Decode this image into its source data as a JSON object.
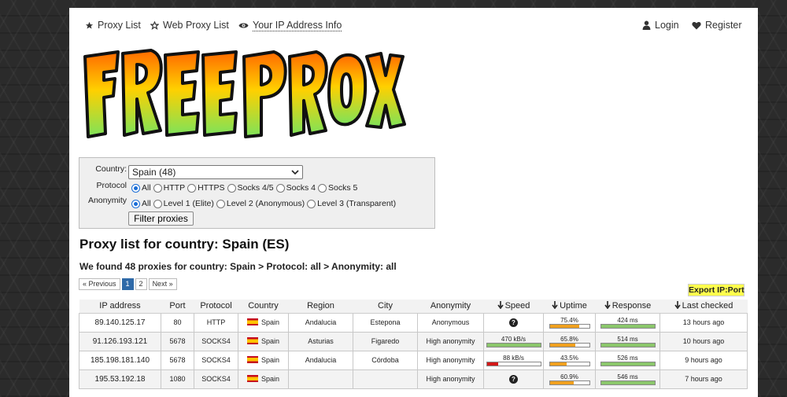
{
  "nav": {
    "proxy_list": "Proxy List",
    "web_proxy_list": "Web Proxy List",
    "ip_info": "Your IP Address Info",
    "login": "Login",
    "register": "Register"
  },
  "logo_text": "FREE PROXY",
  "filter": {
    "country_label": "Country:",
    "country_value": "Spain (48)",
    "protocol_label": "Protocol",
    "protocol_options": [
      "All",
      "HTTP",
      "HTTPS",
      "Socks 4/5",
      "Socks 4",
      "Socks 5"
    ],
    "protocol_selected": "All",
    "anonymity_label": "Anonymity",
    "anonymity_options": [
      "All",
      "Level 1 (Elite)",
      "Level 2 (Anonymous)",
      "Level 3 (Transparent)"
    ],
    "anonymity_selected": "All",
    "button": "Filter proxies"
  },
  "heading": "Proxy list for country: Spain (ES)",
  "found_text": "We found 48 proxies for country: Spain > Protocol: all > Anonymity: all",
  "pagination": {
    "prev": "« Previous",
    "pages": [
      "1",
      "2"
    ],
    "current": "1",
    "next": "Next »"
  },
  "export_label": "Export IP:Port",
  "table": {
    "headers": [
      "IP address",
      "Port",
      "Protocol",
      "Country",
      "Region",
      "City",
      "Anonymity",
      "Speed",
      "Uptime",
      "Response",
      "Last checked"
    ],
    "rows": [
      {
        "ip": "89.140.125.17",
        "port": "80",
        "protocol": "HTTP",
        "country": "Spain",
        "region": "Andalucia",
        "city": "Estepona",
        "anonymity": "Anonymous",
        "speed": "?",
        "speed_pct": null,
        "uptime": "75.4%",
        "uptime_pct": 75.4,
        "response": "424 ms",
        "response_pct": 100,
        "last_checked": "13 hours ago"
      },
      {
        "ip": "91.126.193.121",
        "port": "5678",
        "protocol": "SOCKS4",
        "country": "Spain",
        "region": "Asturias",
        "city": "Figaredo",
        "anonymity": "High anonymity",
        "speed": "470 kB/s",
        "speed_pct": 100,
        "uptime": "65.8%",
        "uptime_pct": 65.8,
        "response": "514 ms",
        "response_pct": 100,
        "last_checked": "10 hours ago"
      },
      {
        "ip": "185.198.181.140",
        "port": "5678",
        "protocol": "SOCKS4",
        "country": "Spain",
        "region": "Andalucia",
        "city": "Córdoba",
        "anonymity": "High anonymity",
        "speed": "88 kB/s",
        "speed_pct": 22,
        "uptime": "43.5%",
        "uptime_pct": 43.5,
        "response": "526 ms",
        "response_pct": 100,
        "last_checked": "9 hours ago"
      },
      {
        "ip": "195.53.192.18",
        "port": "1080",
        "protocol": "SOCKS4",
        "country": "Spain",
        "region": "",
        "city": "",
        "anonymity": "High anonymity",
        "speed": "?",
        "speed_pct": null,
        "uptime": "60.9%",
        "uptime_pct": 60.9,
        "response": "546 ms",
        "response_pct": 100,
        "last_checked": "7 hours ago"
      }
    ]
  },
  "colors": {
    "bar_green": "#8bc76b",
    "bar_orange": "#f0a01e",
    "bar_red": "#d21818",
    "export_bg": "#ffff4d",
    "page_active": "#2f6aa8"
  }
}
